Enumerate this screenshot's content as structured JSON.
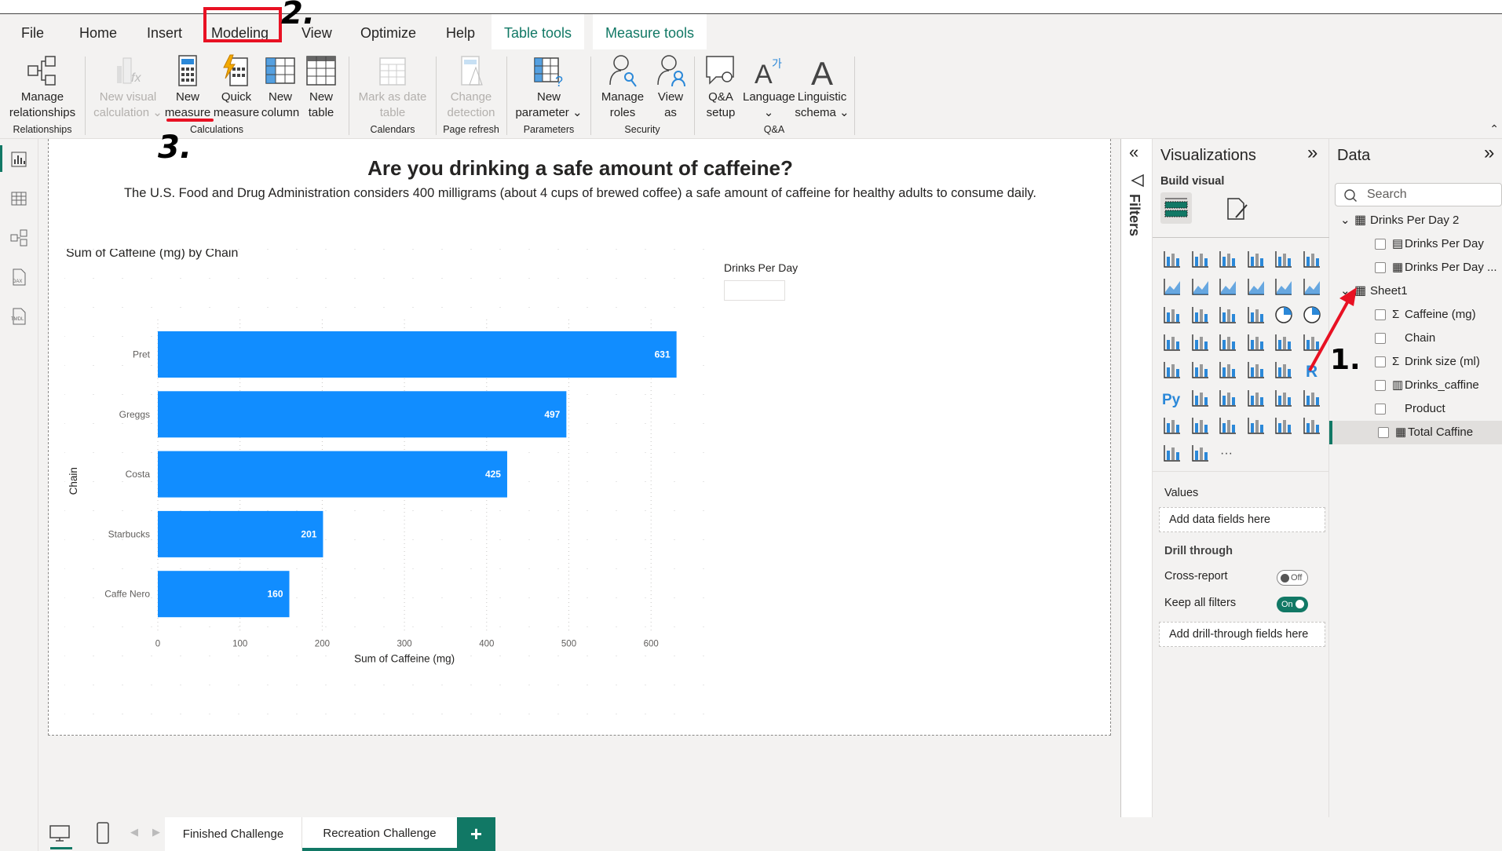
{
  "menu": {
    "tabs": [
      "File",
      "Home",
      "Insert",
      "Modeling",
      "View",
      "Optimize",
      "Help"
    ],
    "context_tabs": [
      "Table tools",
      "Measure tools"
    ],
    "active": "Modeling"
  },
  "ribbon": {
    "buttons": [
      {
        "label": "Manage relationships",
        "disabled": false
      },
      {
        "label": "New visual calculation",
        "disabled": true
      },
      {
        "label": "New measure",
        "disabled": false
      },
      {
        "label": "Quick measure",
        "disabled": false
      },
      {
        "label": "New column",
        "disabled": false
      },
      {
        "label": "New table",
        "disabled": false
      },
      {
        "label": "Mark as date table",
        "disabled": true
      },
      {
        "label": "Change detection",
        "disabled": true
      },
      {
        "label": "New parameter",
        "disabled": false
      },
      {
        "label": "Manage roles",
        "disabled": false
      },
      {
        "label": "View as",
        "disabled": false
      },
      {
        "label": "Q&A setup",
        "disabled": false
      },
      {
        "label": "Language",
        "disabled": false
      },
      {
        "label": "Linguistic schema",
        "disabled": false
      }
    ],
    "groups": [
      "Relationships",
      "Calculations",
      "Calendars",
      "Page refresh",
      "Parameters",
      "Security",
      "Q&A"
    ]
  },
  "annotations": {
    "step1": "1.",
    "step2": "2.",
    "step3": "3.",
    "color": "#e81123"
  },
  "report": {
    "title": "Are you drinking a safe amount of caffeine?",
    "subtitle": "The U.S. Food and Drug Administration considers 400 milligrams (about 4 cups of brewed coffee) a safe amount of caffeine for healthy adults to consume daily.",
    "slicer_title": "Drinks Per Day"
  },
  "chart_data": {
    "type": "bar",
    "orientation": "horizontal",
    "title": "Sum of Caffeine (mg) by Chain",
    "xlabel": "Sum of Caffeine (mg)",
    "ylabel": "Chain",
    "categories": [
      "Pret",
      "Greggs",
      "Costa",
      "Starbucks",
      "Caffe Nero"
    ],
    "values": [
      631,
      497,
      425,
      201,
      160
    ],
    "xlim": [
      0,
      650
    ],
    "xticks": [
      0,
      100,
      200,
      300,
      400,
      500,
      600
    ],
    "color": "#118dff",
    "data_labels": true
  },
  "visualizations": {
    "title": "Visualizations",
    "build_label": "Build visual",
    "icons": [
      "stacked-bar-chart",
      "stacked-column-chart",
      "clustered-bar-chart",
      "clustered-column-chart",
      "100-stacked-bar-chart",
      "100-stacked-column-chart",
      "line-chart",
      "area-chart",
      "stacked-area-chart",
      "100-stacked-area-chart",
      "line-clustered-column-chart",
      "line-stacked-column-chart",
      "ribbon-chart",
      "waterfall-chart",
      "funnel-chart",
      "scatter-chart",
      "pie-chart",
      "donut-chart",
      "treemap",
      "map",
      "filled-map",
      "shape-map",
      "azure-map",
      "gauge",
      "card-new",
      "kpi",
      "slicer",
      "table",
      "matrix",
      "r-visual",
      "python-visual",
      "key-influencers",
      "decomposition-tree",
      "qa-visual",
      "smart-narrative",
      "metrics",
      "paginated-report",
      "button-slicer",
      "text-slicer",
      "list-slicer",
      "image",
      "arcgis-map",
      "power-apps",
      "power-automate",
      "more"
    ],
    "values_label": "Values",
    "values_placeholder": "Add data fields here",
    "drill_label": "Drill through",
    "cross_report_label": "Cross-report",
    "cross_report_state": "Off",
    "keep_filters_label": "Keep all filters",
    "keep_filters_state": "On",
    "drill_placeholder": "Add drill-through fields here"
  },
  "filters": {
    "label": "Filters"
  },
  "data_pane": {
    "title": "Data",
    "search_placeholder": "Search",
    "tables": [
      {
        "name": "Drinks Per Day 2",
        "fields": [
          {
            "name": "Drinks Per Day",
            "icon": "parameter"
          },
          {
            "name": "Drinks Per Day ...",
            "icon": "measure"
          }
        ]
      },
      {
        "name": "Sheet1",
        "fields": [
          {
            "name": "Caffeine (mg)",
            "icon": "sigma"
          },
          {
            "name": "Chain",
            "icon": ""
          },
          {
            "name": "Drink size (ml)",
            "icon": "sigma"
          },
          {
            "name": "Drinks_caffine",
            "icon": "calc-column"
          },
          {
            "name": "Product",
            "icon": ""
          },
          {
            "name": "Total Caffine",
            "icon": "measure",
            "selected": true
          }
        ]
      }
    ]
  },
  "pages": {
    "tabs": [
      "Finished Challenge",
      "Recreation Challenge"
    ],
    "active": "Recreation Challenge",
    "add": "+"
  },
  "colors": {
    "accent": "#117865",
    "bar": "#118dff"
  }
}
